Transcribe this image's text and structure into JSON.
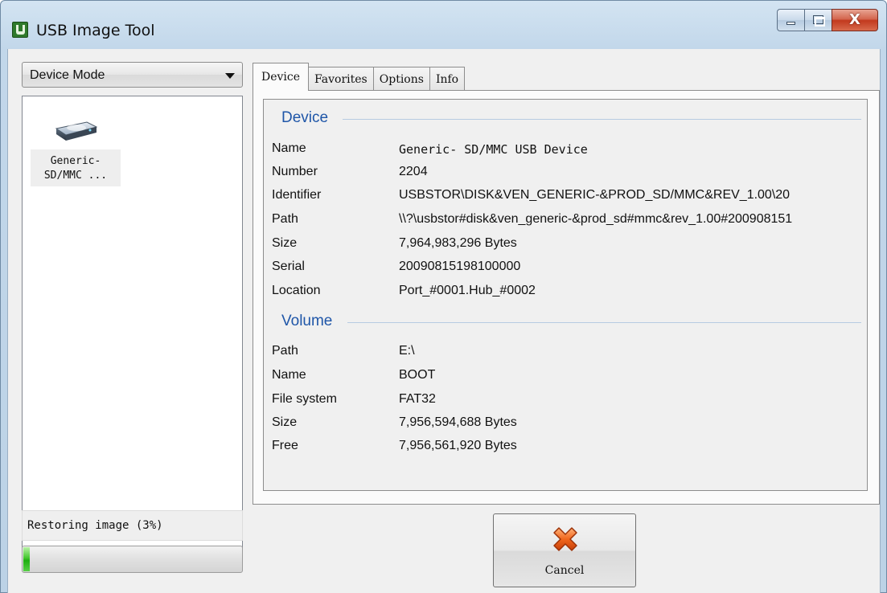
{
  "window": {
    "title": "USB Image Tool",
    "controls": {
      "minimize": "minimize",
      "maximize": "maximize",
      "close": "X"
    }
  },
  "left_panel": {
    "mode_select": {
      "value": "Device Mode"
    },
    "devices": [
      {
        "label_line1": "Generic-",
        "label_line2": "SD/MMC ...",
        "icon": "usb-drive-icon"
      }
    ],
    "status": "Restoring image (3%)",
    "progress": 0.03
  },
  "tabs": [
    {
      "label": "Device",
      "active": true
    },
    {
      "label": "Favorites",
      "active": false
    },
    {
      "label": "Options",
      "active": false
    },
    {
      "label": "Info",
      "active": false
    }
  ],
  "device_group": {
    "title": "Device",
    "rows": [
      {
        "label": "Name",
        "value": "Generic- SD/MMC USB Device"
      },
      {
        "label": "Number",
        "value": "2204"
      },
      {
        "label": "Identifier",
        "value": "USBSTOR\\DISK&VEN_GENERIC-&PROD_SD/MMC&REV_1.00\\20"
      },
      {
        "label": "Path",
        "value": "\\\\?\\usbstor#disk&ven_generic-&prod_sd#mmc&rev_1.00#200908151"
      },
      {
        "label": "Size",
        "value": "7,964,983,296 Bytes"
      },
      {
        "label": "Serial",
        "value": "20090815198100000"
      },
      {
        "label": "Location",
        "value": "Port_#0001.Hub_#0002"
      }
    ]
  },
  "volume_group": {
    "title": "Volume",
    "rows": [
      {
        "label": "Path",
        "value": "E:\\"
      },
      {
        "label": "Name",
        "value": "BOOT"
      },
      {
        "label": "File system",
        "value": "FAT32"
      },
      {
        "label": "Size",
        "value": "7,956,594,688 Bytes"
      },
      {
        "label": "Free",
        "value": "7,956,561,920 Bytes"
      }
    ]
  },
  "cancel_button": {
    "label": "Cancel",
    "icon": "cancel-x-icon"
  },
  "colors": {
    "group_title": "#1f56a8",
    "progress": "#2fbf1e",
    "cancel_icon": "#e8591a"
  }
}
